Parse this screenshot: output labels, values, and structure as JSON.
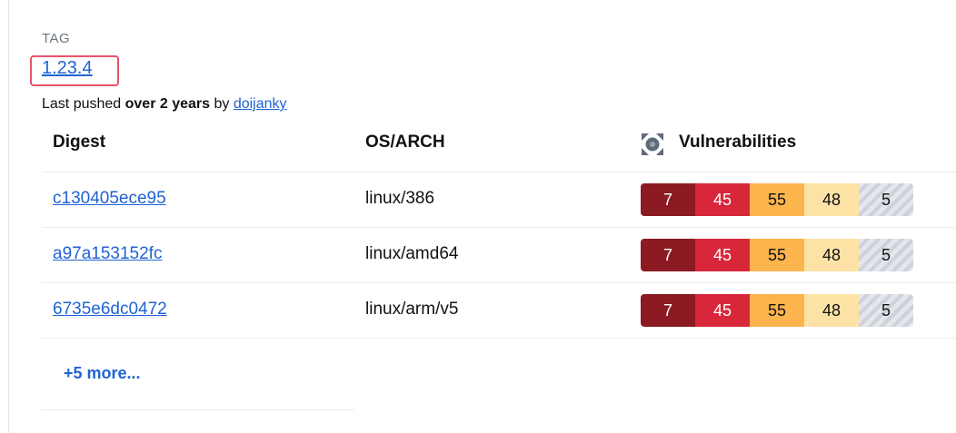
{
  "tag": {
    "caption": "TAG",
    "name": "1.23.4",
    "pushed_prefix": "Last pushed ",
    "pushed_when": "over 2 years",
    "pushed_by_word": " by ",
    "pushed_user": "doijanky"
  },
  "table": {
    "headers": {
      "digest": "Digest",
      "os_arch": "OS/ARCH",
      "vulnerabilities": "Vulnerabilities"
    },
    "rows": [
      {
        "digest": "c130405ece95",
        "os_arch": "linux/386",
        "vulns": {
          "critical": "7",
          "high": "45",
          "medium": "55",
          "low": "48",
          "unspecified": "5"
        }
      },
      {
        "digest": "a97a153152fc",
        "os_arch": "linux/amd64",
        "vulns": {
          "critical": "7",
          "high": "45",
          "medium": "55",
          "low": "48",
          "unspecified": "5"
        }
      },
      {
        "digest": "6735e6dc0472",
        "os_arch": "linux/arm/v5",
        "vulns": {
          "critical": "7",
          "high": "45",
          "medium": "55",
          "low": "48",
          "unspecified": "5"
        }
      }
    ],
    "more_label": "+5 more..."
  },
  "icons": {
    "vulnerabilities": "scout-vulnerability-icon"
  },
  "colors": {
    "link": "#2063d4",
    "critical": "#8b1a22",
    "high": "#d8273a",
    "medium": "#fcb44d",
    "low": "#fde2a6",
    "unspecified": "#cdd1d9",
    "highlight": "#e8526b"
  }
}
